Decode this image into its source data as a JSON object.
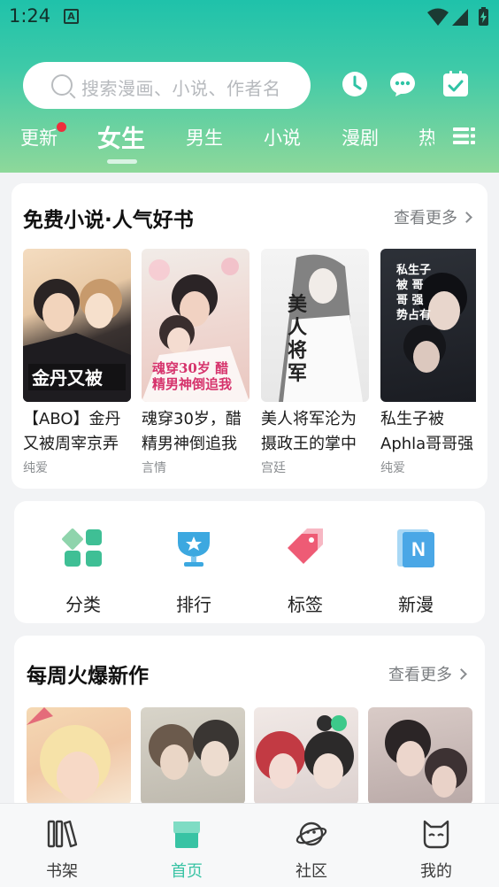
{
  "status_bar": {
    "time": "1:24",
    "sim_label": "A"
  },
  "search": {
    "placeholder": "搜索漫画、小说、作者名"
  },
  "header_icons": [
    "clock-icon",
    "chat-icon",
    "checkin-icon"
  ],
  "tabs": [
    {
      "label": "更新",
      "has_dot": true
    },
    {
      "label": "女生",
      "active": true
    },
    {
      "label": "男生"
    },
    {
      "label": "小说"
    },
    {
      "label": "漫剧"
    },
    {
      "label": "热"
    }
  ],
  "free_novels": {
    "title": "免费小说·人气好书",
    "more": "查看更多",
    "books": [
      {
        "title": "【ABO】金丹又被周宰京弄",
        "tag": "纯爱",
        "cover_text": "金丹又被"
      },
      {
        "title": "魂穿30岁，醋精男神倒追我",
        "tag": "言情",
        "cover_text": "魂穿30岁 醋精男神倒追我"
      },
      {
        "title": "美人将军沦为摄政王的掌中",
        "tag": "宫廷",
        "cover_text": "美人将军"
      },
      {
        "title": "私生子被Aphla哥哥强",
        "tag": "纯爱",
        "cover_text": "私生子被 哥哥 强势占有"
      }
    ]
  },
  "categories": [
    {
      "label": "分类",
      "icon": "grid-icon"
    },
    {
      "label": "排行",
      "icon": "trophy-icon"
    },
    {
      "label": "标签",
      "icon": "tag-icon"
    },
    {
      "label": "新漫",
      "icon": "new-manga-icon"
    }
  ],
  "weekly": {
    "title": "每周火爆新作",
    "more": "查看更多"
  },
  "bottom_nav": [
    {
      "label": "书架",
      "icon": "bookshelf-icon"
    },
    {
      "label": "首页",
      "icon": "home-store-icon",
      "active": true
    },
    {
      "label": "社区",
      "icon": "planet-icon"
    },
    {
      "label": "我的",
      "icon": "cat-face-icon"
    }
  ],
  "colors": {
    "accent": "#38c3a4",
    "header_top": "#1fc2aa",
    "header_bottom": "#8ed89a",
    "dot": "#ee2e3c"
  }
}
